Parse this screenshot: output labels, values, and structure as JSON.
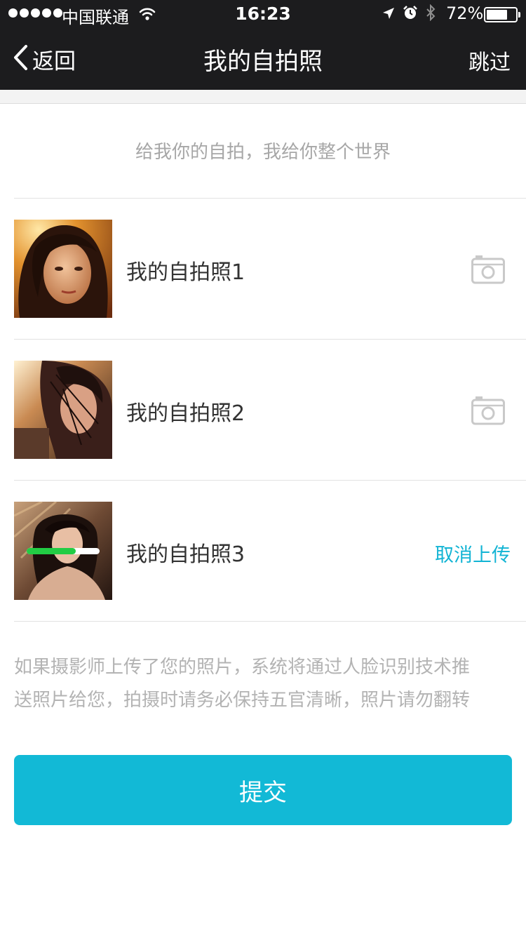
{
  "status_bar": {
    "carrier": "中国联通",
    "time": "16:23",
    "battery_percent": "72%",
    "battery_level": 0.72,
    "icons": [
      "signal-dots-icon",
      "wifi-icon",
      "location-arrow-icon",
      "alarm-icon",
      "bluetooth-icon",
      "battery-icon"
    ]
  },
  "nav": {
    "back_label": "返回",
    "title": "我的自拍照",
    "skip_label": "跳过"
  },
  "slogan": "给我你的自拍，我给你整个世界",
  "photos": [
    {
      "label": "我的自拍照1",
      "action_icon": "camera-icon"
    },
    {
      "label": "我的自拍照2",
      "action_icon": "camera-icon"
    },
    {
      "label": "我的自拍照3",
      "action_label": "取消上传",
      "upload_progress": 0.67
    }
  ],
  "note": {
    "line1": "如果摄影师上传了您的照片，系统将通过人脸识别技术推",
    "line2": "送照片给您，拍摄时请务必保持五官清晰，照片请勿翻转"
  },
  "submit_label": "提交",
  "colors": {
    "nav_bg": "#1c1c1e",
    "accent": "#12b9d6",
    "cancel_text": "#12b4d4",
    "progress_fill": "#22cc44",
    "hint_text": "#a7a7a7"
  }
}
